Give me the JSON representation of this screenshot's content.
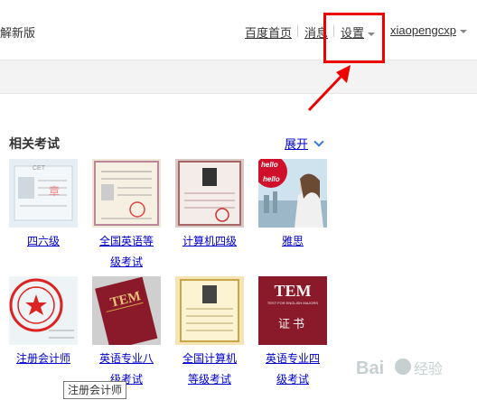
{
  "header": {
    "left_text": "解新版",
    "nav": [
      {
        "label": "百度首页"
      },
      {
        "label": "消息"
      },
      {
        "label": "设置"
      },
      {
        "label": "xiaopengcxp"
      }
    ]
  },
  "section": {
    "title": "相关考试",
    "expand_label": "展开"
  },
  "items_row1": [
    {
      "label_lines": [
        "四六级"
      ]
    },
    {
      "label_lines": [
        "全国英语等",
        "级考试"
      ]
    },
    {
      "label_lines": [
        "计算机四级"
      ]
    },
    {
      "label_lines": [
        "雅思"
      ]
    }
  ],
  "items_row2": [
    {
      "label_lines": [
        "注册会计师"
      ]
    },
    {
      "label_lines": [
        "英语专业八",
        "级考试"
      ]
    },
    {
      "label_lines": [
        "全国计算机",
        "等级考试"
      ]
    },
    {
      "label_lines": [
        "英语专业四",
        "级考试"
      ]
    }
  ],
  "thumb_text": {
    "cet_badge": "CET",
    "ielts_hello_1": "hello",
    "ielts_hello_2": "hello",
    "tem_1": "TEM",
    "tem_2": "TEM",
    "tem_sub": "TEST FOR ENGLISH MAJORS",
    "tem_cert": "证书"
  },
  "tooltip": "注册会计师",
  "watermark": "Bai经验",
  "colors": {
    "link": "#0000cc",
    "highlight": "#ee0000",
    "tem_red": "#8a1a2a"
  }
}
